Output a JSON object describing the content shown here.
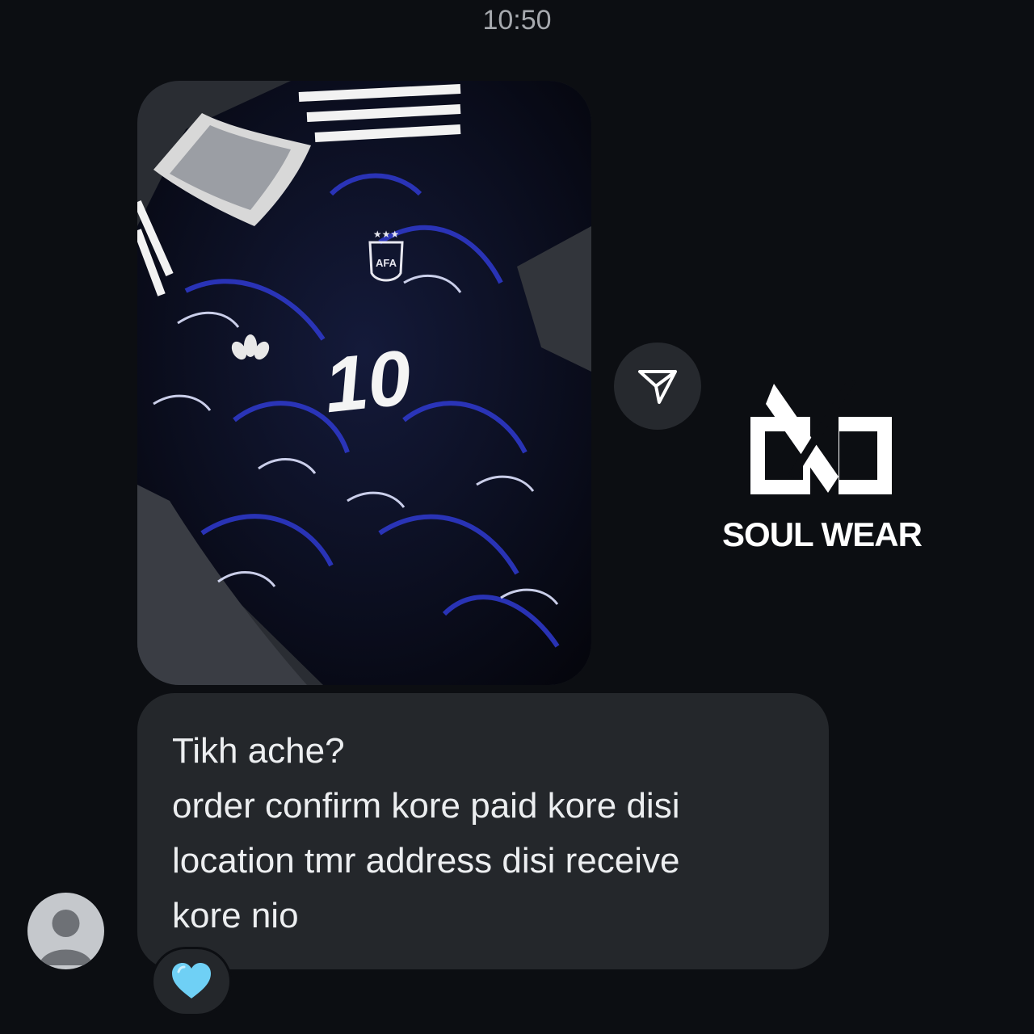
{
  "timestamp": "10:50",
  "message": {
    "image_alt": "Black and blue football jersey with number 10",
    "jersey_number": "10",
    "crest_text": "AFA",
    "lines": [
      "Tikh ache?",
      "order confirm kore paid kore disi",
      "location tmr address disi receive",
      "kore nio"
    ],
    "reaction": "light-blue-heart"
  },
  "watermark": {
    "text": "SOUL WEAR"
  },
  "icons": {
    "share": "paper-plane-icon",
    "avatar": "default-user-avatar-icon"
  },
  "colors": {
    "background": "#0c0e12",
    "bubble": "#24272b",
    "timestamp": "#a6a9ae",
    "reaction_heart": "#6fd0f5"
  }
}
